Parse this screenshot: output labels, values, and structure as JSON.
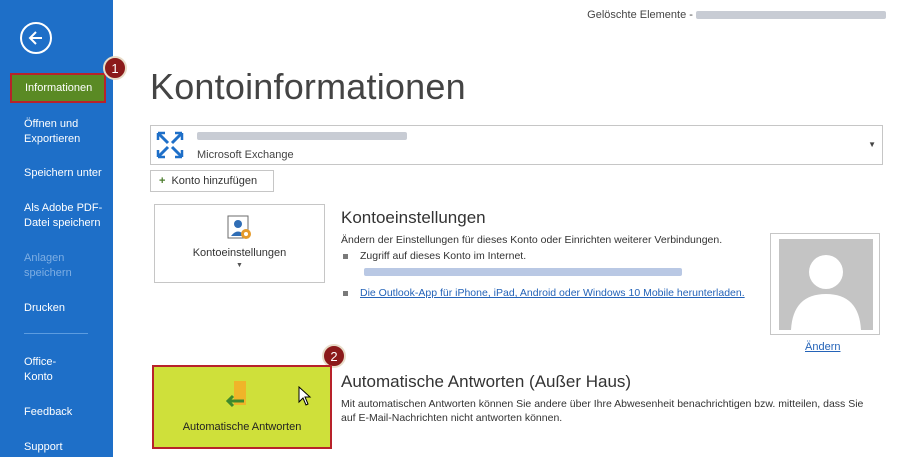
{
  "sidebar": {
    "back_icon": "arrow-left-circle-icon",
    "items": [
      {
        "label": "Informationen"
      },
      {
        "label": "Öffnen und\nExportieren"
      },
      {
        "label": "Speichern unter"
      },
      {
        "label": "Als Adobe PDF-\nDatei speichern"
      },
      {
        "label": "Anlagen\nspeichern"
      },
      {
        "label": "Drucken"
      },
      {
        "label": "Office-\nKonto"
      },
      {
        "label": "Feedback"
      },
      {
        "label": "Support"
      }
    ]
  },
  "badges": {
    "one": "1",
    "two": "2"
  },
  "topbar": {
    "folder_label": "Gelöschte Elemente -"
  },
  "main": {
    "title": "Kontoinformationen",
    "account": {
      "type": "Microsoft Exchange"
    },
    "add_account_label": "Konto hinzufügen",
    "settings": {
      "tile_label": "Kontoeinstellungen",
      "title": "Kontoeinstellungen",
      "description": "Ändern der Einstellungen für dieses Konto oder Einrichten weiterer Verbindungen.",
      "bullet_access": "Zugriff auf dieses Konto im Internet.",
      "bullet_app_link": "Die Outlook-App für iPhone, iPad, Android oder Windows 10 Mobile herunterladen."
    },
    "photo": {
      "change_label": "Ändern"
    },
    "auto_reply": {
      "tile_label": "Automatische Antworten",
      "title": "Automatische Antworten (Außer Haus)",
      "description": "Mit automatischen Antworten können Sie andere über Ihre Abwesenheit benachrichtigen bzw. mitteilen, dass Sie auf E-Mail-Nachrichten nicht antworten können."
    }
  },
  "colors": {
    "sidebar": "#1e6fc8",
    "active": "#5a8a24",
    "highlight": "#cfe03a",
    "badge": "#8b1a1a",
    "link": "#2463b8"
  }
}
